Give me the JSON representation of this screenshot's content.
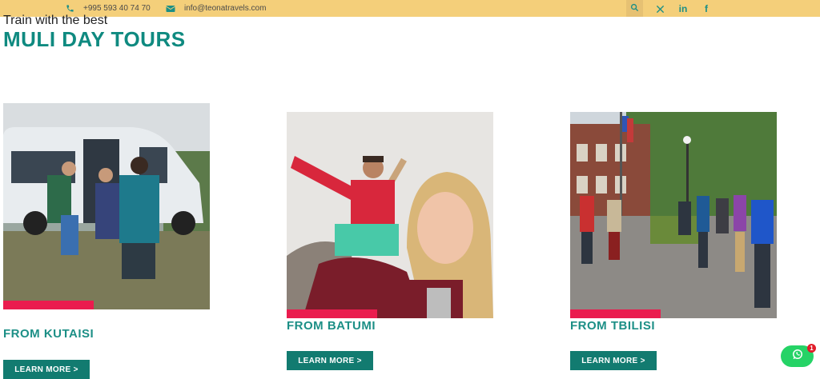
{
  "topbar": {
    "phone": "+995 593 40 74 70",
    "email": "info@teonatravels.com",
    "phone_icon": "phone-icon",
    "email_icon": "envelope-icon",
    "search_icon": "search-icon",
    "socials": [
      "x-icon",
      "linkedin-icon",
      "facebook-icon"
    ]
  },
  "section": {
    "lead": "Train with the best",
    "title": "MULI DAY TOURS"
  },
  "cards": [
    {
      "title": "FROM KUTAISI",
      "button": "LEARN MORE >"
    },
    {
      "title": "FROM BATUMI",
      "button": "LEARN MORE >"
    },
    {
      "title": "FROM TBILISI",
      "button": "LEARN MORE >"
    }
  ],
  "whatsapp": {
    "badge": "1"
  },
  "colors": {
    "topbar": "#f4cf7a",
    "teal": "#1c8f86",
    "accent": "#ea1c4e",
    "button": "#127b70"
  }
}
